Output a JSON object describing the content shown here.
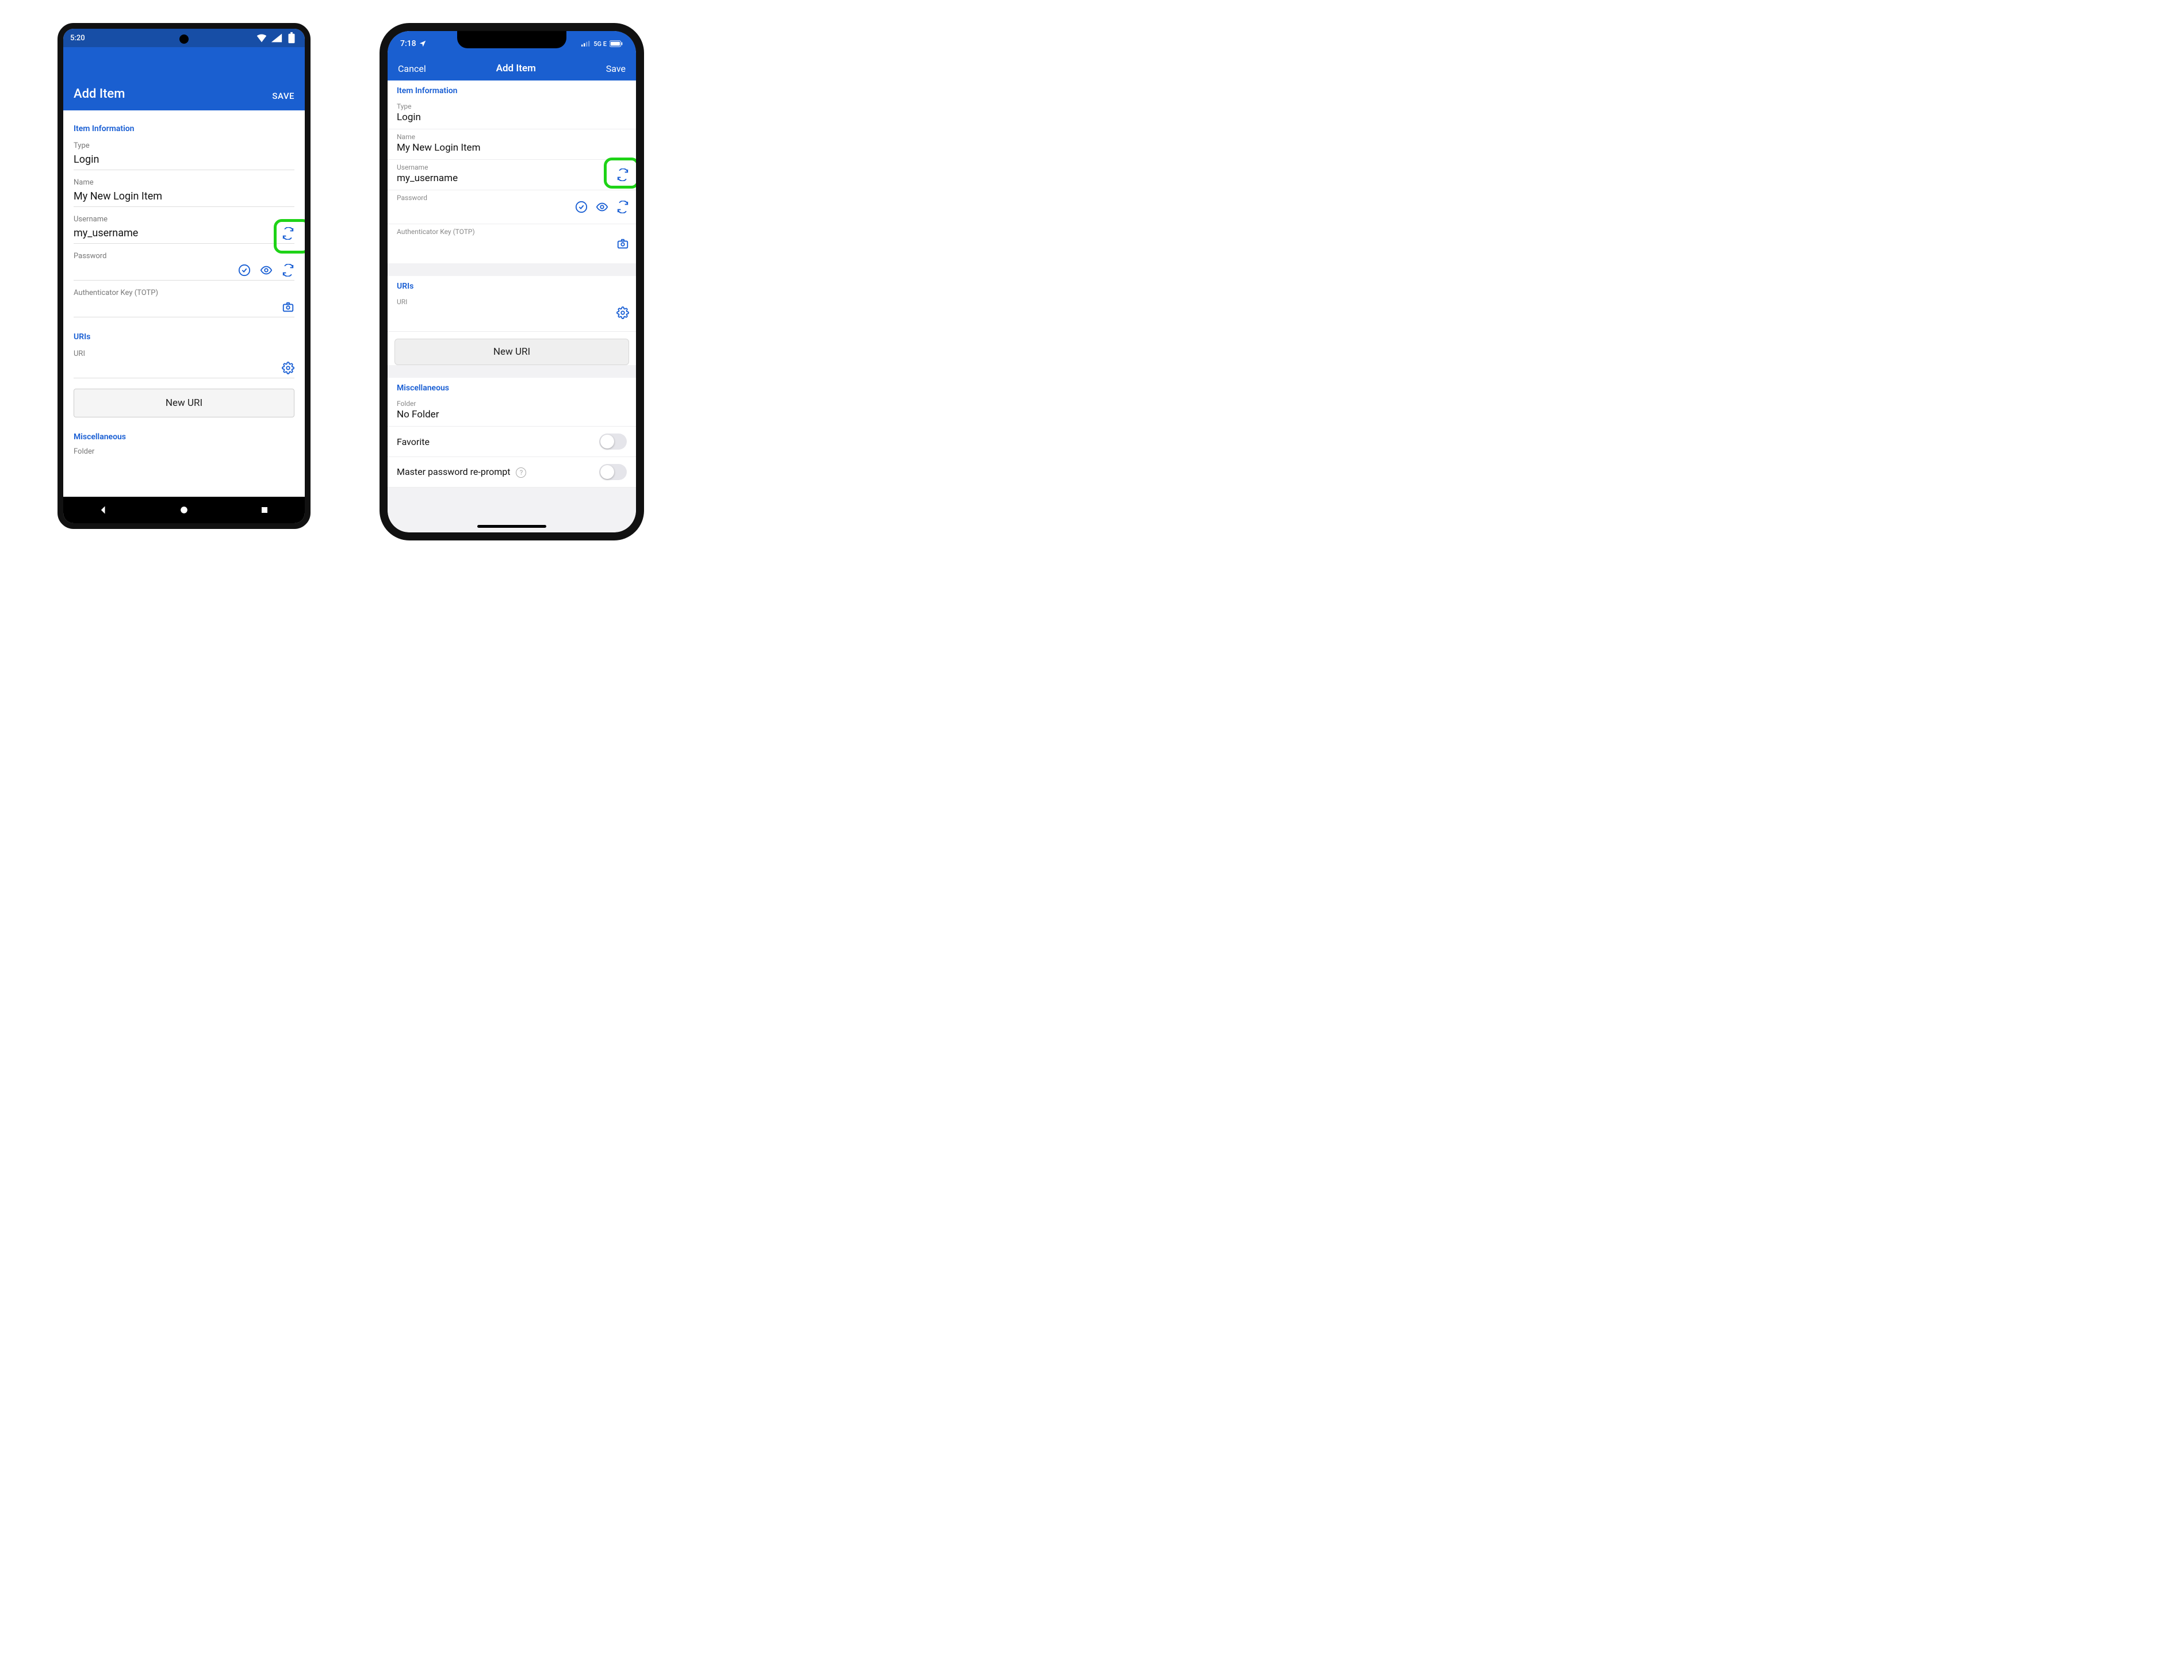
{
  "android": {
    "status_time": "5:20",
    "titlebar": {
      "title": "Add Item",
      "save": "SAVE"
    },
    "section_item_info": "Item Information",
    "type": {
      "label": "Type",
      "value": "Login"
    },
    "name": {
      "label": "Name",
      "value": "My New Login Item"
    },
    "username": {
      "label": "Username",
      "value": "my_username"
    },
    "password": {
      "label": "Password",
      "value": ""
    },
    "totp": {
      "label": "Authenticator Key (TOTP)",
      "value": ""
    },
    "section_uris": "URIs",
    "uri": {
      "label": "URI",
      "value": ""
    },
    "new_uri_btn": "New URI",
    "section_misc": "Miscellaneous",
    "folder_label": "Folder"
  },
  "ios": {
    "status_time": "7:18",
    "status_net": "5G E",
    "titlebar": {
      "cancel": "Cancel",
      "title": "Add Item",
      "save": "Save"
    },
    "section_item_info": "Item Information",
    "type": {
      "label": "Type",
      "value": "Login"
    },
    "name": {
      "label": "Name",
      "value": "My New Login Item"
    },
    "username": {
      "label": "Username",
      "value": "my_username"
    },
    "password": {
      "label": "Password",
      "value": ""
    },
    "totp": {
      "label": "Authenticator Key (TOTP)",
      "value": ""
    },
    "section_uris": "URIs",
    "uri": {
      "label": "URI",
      "value": ""
    },
    "new_uri_btn": "New URI",
    "section_misc": "Miscellaneous",
    "folder": {
      "label": "Folder",
      "value": "No Folder"
    },
    "favorite_label": "Favorite",
    "reprompt_label": "Master password re-prompt"
  },
  "colors": {
    "brand": "#1a5fd0",
    "link": "#175dd3",
    "highlight": "#1ed317"
  }
}
